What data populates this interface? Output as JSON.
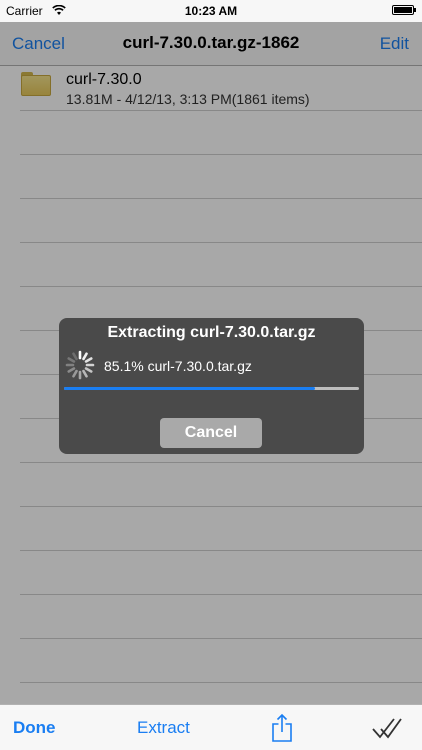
{
  "status_bar": {
    "carrier": "Carrier",
    "time": "10:23 AM"
  },
  "nav": {
    "cancel_label": "Cancel",
    "title": "curl-7.30.0.tar.gz-1862",
    "edit_label": "Edit"
  },
  "files": [
    {
      "name": "curl-7.30.0",
      "detail": "13.81M - 4/12/13, 3:13 PM(1861 items)",
      "icon": "folder-icon"
    }
  ],
  "dialog": {
    "title": "Extracting curl-7.30.0.tar.gz",
    "progress_text": "85.1% curl-7.30.0.tar.gz",
    "progress_fraction": 0.851,
    "cancel_label": "Cancel"
  },
  "toolbar": {
    "done_label": "Done",
    "extract_label": "Extract",
    "share_icon": "share-icon",
    "check_icon": "double-check-icon"
  },
  "colors": {
    "accent": "#1a7ef2",
    "dialog_bg": "#4a4a4a",
    "overlay": "rgba(0,0,0,0.34)"
  }
}
